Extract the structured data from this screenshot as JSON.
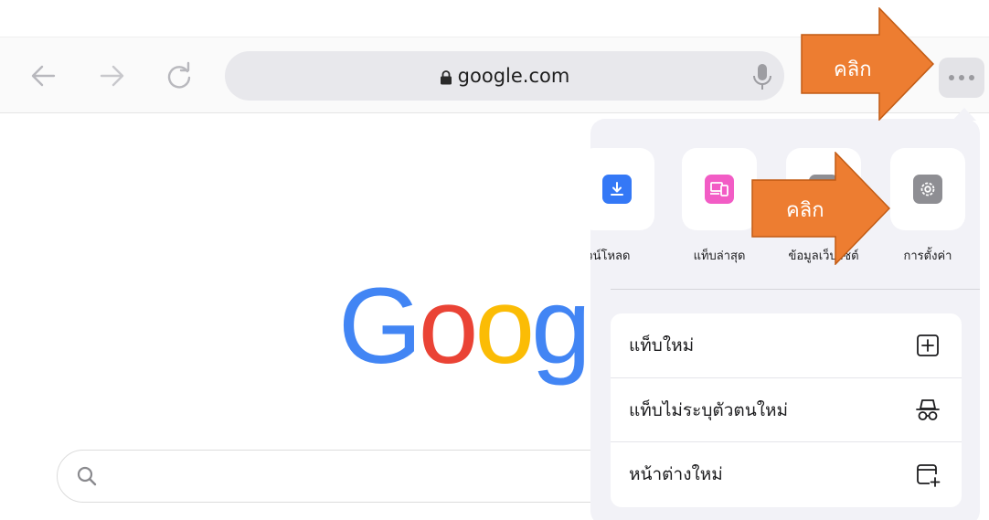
{
  "toolbar": {
    "url": "google.com",
    "back_icon": "back-arrow-icon",
    "forward_icon": "forward-arrow-icon",
    "reload_icon": "reload-icon",
    "mic_icon": "microphone-icon",
    "more_icon": "more-dots-icon"
  },
  "google": {
    "logo_letters": [
      "G",
      "o",
      "o",
      "g"
    ],
    "logo_colors": [
      "#4285f4",
      "#ea4335",
      "#fbbc05",
      "#4285f4"
    ],
    "search_icon": "search-icon"
  },
  "menu": {
    "tray": [
      {
        "label": "าวน์โหลด",
        "icon": "download-icon",
        "color": "#3478f6"
      },
      {
        "label": "แท็บล่าสุด",
        "icon": "recent-tabs-icon",
        "color": "#f25cc5"
      },
      {
        "label": "ข้อมูลเว็บไซต์",
        "icon": "site-info-icon",
        "color": "#8e8e93"
      },
      {
        "label": "การตั้งค่า",
        "icon": "gear-icon",
        "color": "#8e8e93"
      }
    ],
    "items": [
      {
        "label": "แท็บใหม่",
        "icon": "new-tab-icon"
      },
      {
        "label": "แท็บไม่ระบุตัวตนใหม่",
        "icon": "incognito-icon"
      },
      {
        "label": "หน้าต่างใหม่",
        "icon": "new-window-icon"
      }
    ]
  },
  "annotations": {
    "arrow_top_text": "คลิก",
    "arrow_mid_text": "คลิก",
    "arrow_color": "#ed7d31"
  }
}
